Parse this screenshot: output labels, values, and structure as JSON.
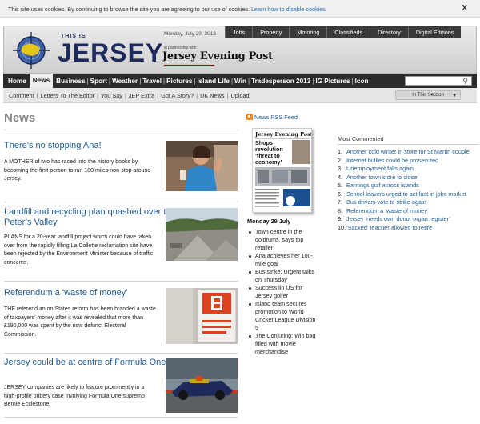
{
  "cookie": {
    "text": "This site uses cookies. By continuing to browse the site you are agreeing to our use of cookies.",
    "link": "Learn how to disable cookies.",
    "close": "X"
  },
  "header": {
    "logo_small": "THIS IS",
    "logo_big": "JERSEY",
    "date": "Monday, July 29, 2013",
    "partner_text": "in partnership with",
    "partner_name": "Jersey Evening Post",
    "top_nav": [
      "Jobs",
      "Property",
      "Motoring",
      "Classifieds",
      "Directory",
      "Digital Editions"
    ]
  },
  "main_nav": {
    "home": "Home",
    "active": "News",
    "items": [
      "Business",
      "Sport",
      "Weather",
      "Travel",
      "Pictures",
      "Island Life",
      "Win",
      "Tradesperson 2013",
      "IG Pictures",
      "Icon"
    ]
  },
  "sub_nav": {
    "items": [
      "Comment",
      "Letters To The Editor",
      "You Say",
      "JEP Extra",
      "Got A Story?",
      "UK News",
      "Upload"
    ],
    "in_section": "In This Section"
  },
  "page": {
    "heading": "News"
  },
  "stories": [
    {
      "headline": "There’s no stopping Ana!",
      "summary": "A MOTHER of two has raced into the history books by becoming the first person to run 100 miles non-stop around Jersey."
    },
    {
      "headline": "Landfill and recycling plan quashed over traffic fears in St Peter’s Valley",
      "summary": "PLANS for a 20-year landfill project which could have taken over from the rapidly filling La Collette reclamation site have been rejected by the Environment Minister because of traffic concerns."
    },
    {
      "headline": "Referendum a ‘waste of money’",
      "summary": "THE referendum on States reform has been branded a waste of taxpayers’ money after it was revealed that more than £190,000 was spent by the now defunct Electoral Commission."
    },
    {
      "headline": "Jersey could be at centre of Formula One bribery case",
      "summary": "JERSEY companies are likely to feature prominently in a high-profile bribery case involving Formula One supremo Bernie Ecclestone."
    }
  ],
  "edition": {
    "rss_label": "News RSS Feed",
    "paper_masthead": "Jersey Evening Post",
    "paper_headline": "Shops revolution ‘threat to economy’",
    "date_label": "Monday 29 July",
    "items": [
      "Town centre in the doldrums, says top retailer",
      "Ana achieves her 100-mile goal",
      "Bus strike: Urgent talks on Thursday",
      "Success iin US for Jersey golfer",
      "Island team secures promotion to World Cricket League Division 5",
      "The Conjuring: Win bag filled with movie merchandise"
    ]
  },
  "most_commented": {
    "title": "Most Commented",
    "items": [
      "Another cold winter in store for St Martin couple",
      "Internet bullies could be prosecuted",
      "Unemployment falls again",
      "Another town store to close",
      "Earnings gulf across islands",
      "School leavers urged to act fast in jobs market",
      "Bus drivers vote to strike again",
      "Referendum a ‘waste of money’",
      "Jersey ‘needs own donor organ register’",
      "‘Sacked’ teacher allowed to retire"
    ]
  },
  "colors": {
    "link": "#1f5d96",
    "nav_bg": "#2b2b2b",
    "logo_navy": "#1e2a5c",
    "logo_yellow": "#e3c51e",
    "rss_orange": "#f08a24"
  }
}
